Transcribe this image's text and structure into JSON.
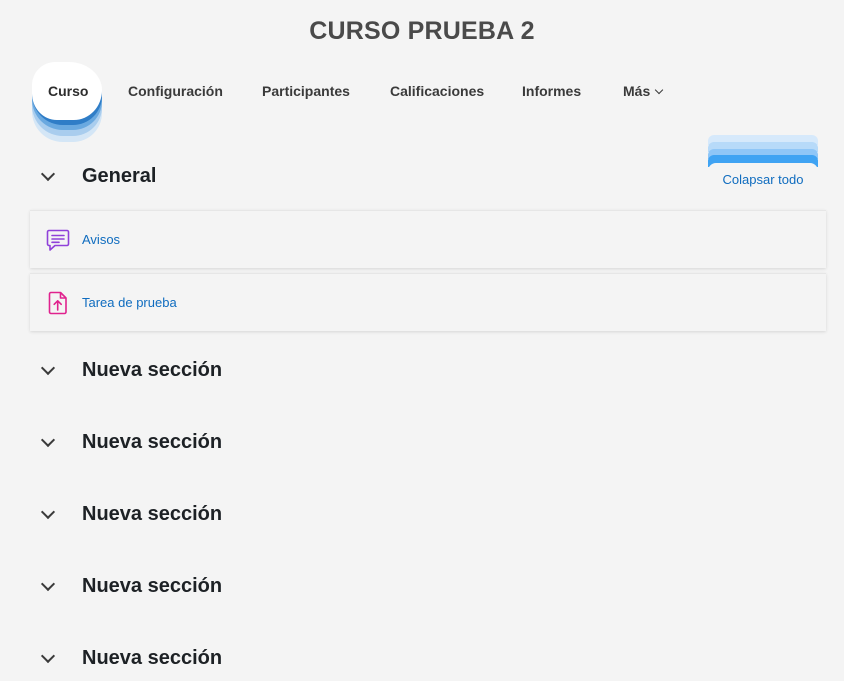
{
  "course": {
    "title": "CURSO PRUEBA 2"
  },
  "tabs": [
    {
      "label": "Curso",
      "active": true
    },
    {
      "label": "Configuración"
    },
    {
      "label": "Participantes"
    },
    {
      "label": "Calificaciones"
    },
    {
      "label": "Informes"
    },
    {
      "label": "Más"
    }
  ],
  "collapse_all": {
    "label": "Colapsar todo"
  },
  "sections": [
    {
      "title": "General",
      "activities": [
        {
          "name": "Avisos",
          "icon": "forum-icon",
          "color": "#8f41d9"
        },
        {
          "name": "Tarea de prueba",
          "icon": "assignment-upload-icon",
          "color": "#e0228e"
        }
      ]
    },
    {
      "title": "Nueva sección"
    },
    {
      "title": "Nueva sección"
    },
    {
      "title": "Nueva sección"
    },
    {
      "title": "Nueva sección"
    },
    {
      "title": "Nueva sección"
    }
  ],
  "colors": {
    "link": "#0f6cbf",
    "accent": "#3fa3f3",
    "background": "#f4f4f4"
  }
}
